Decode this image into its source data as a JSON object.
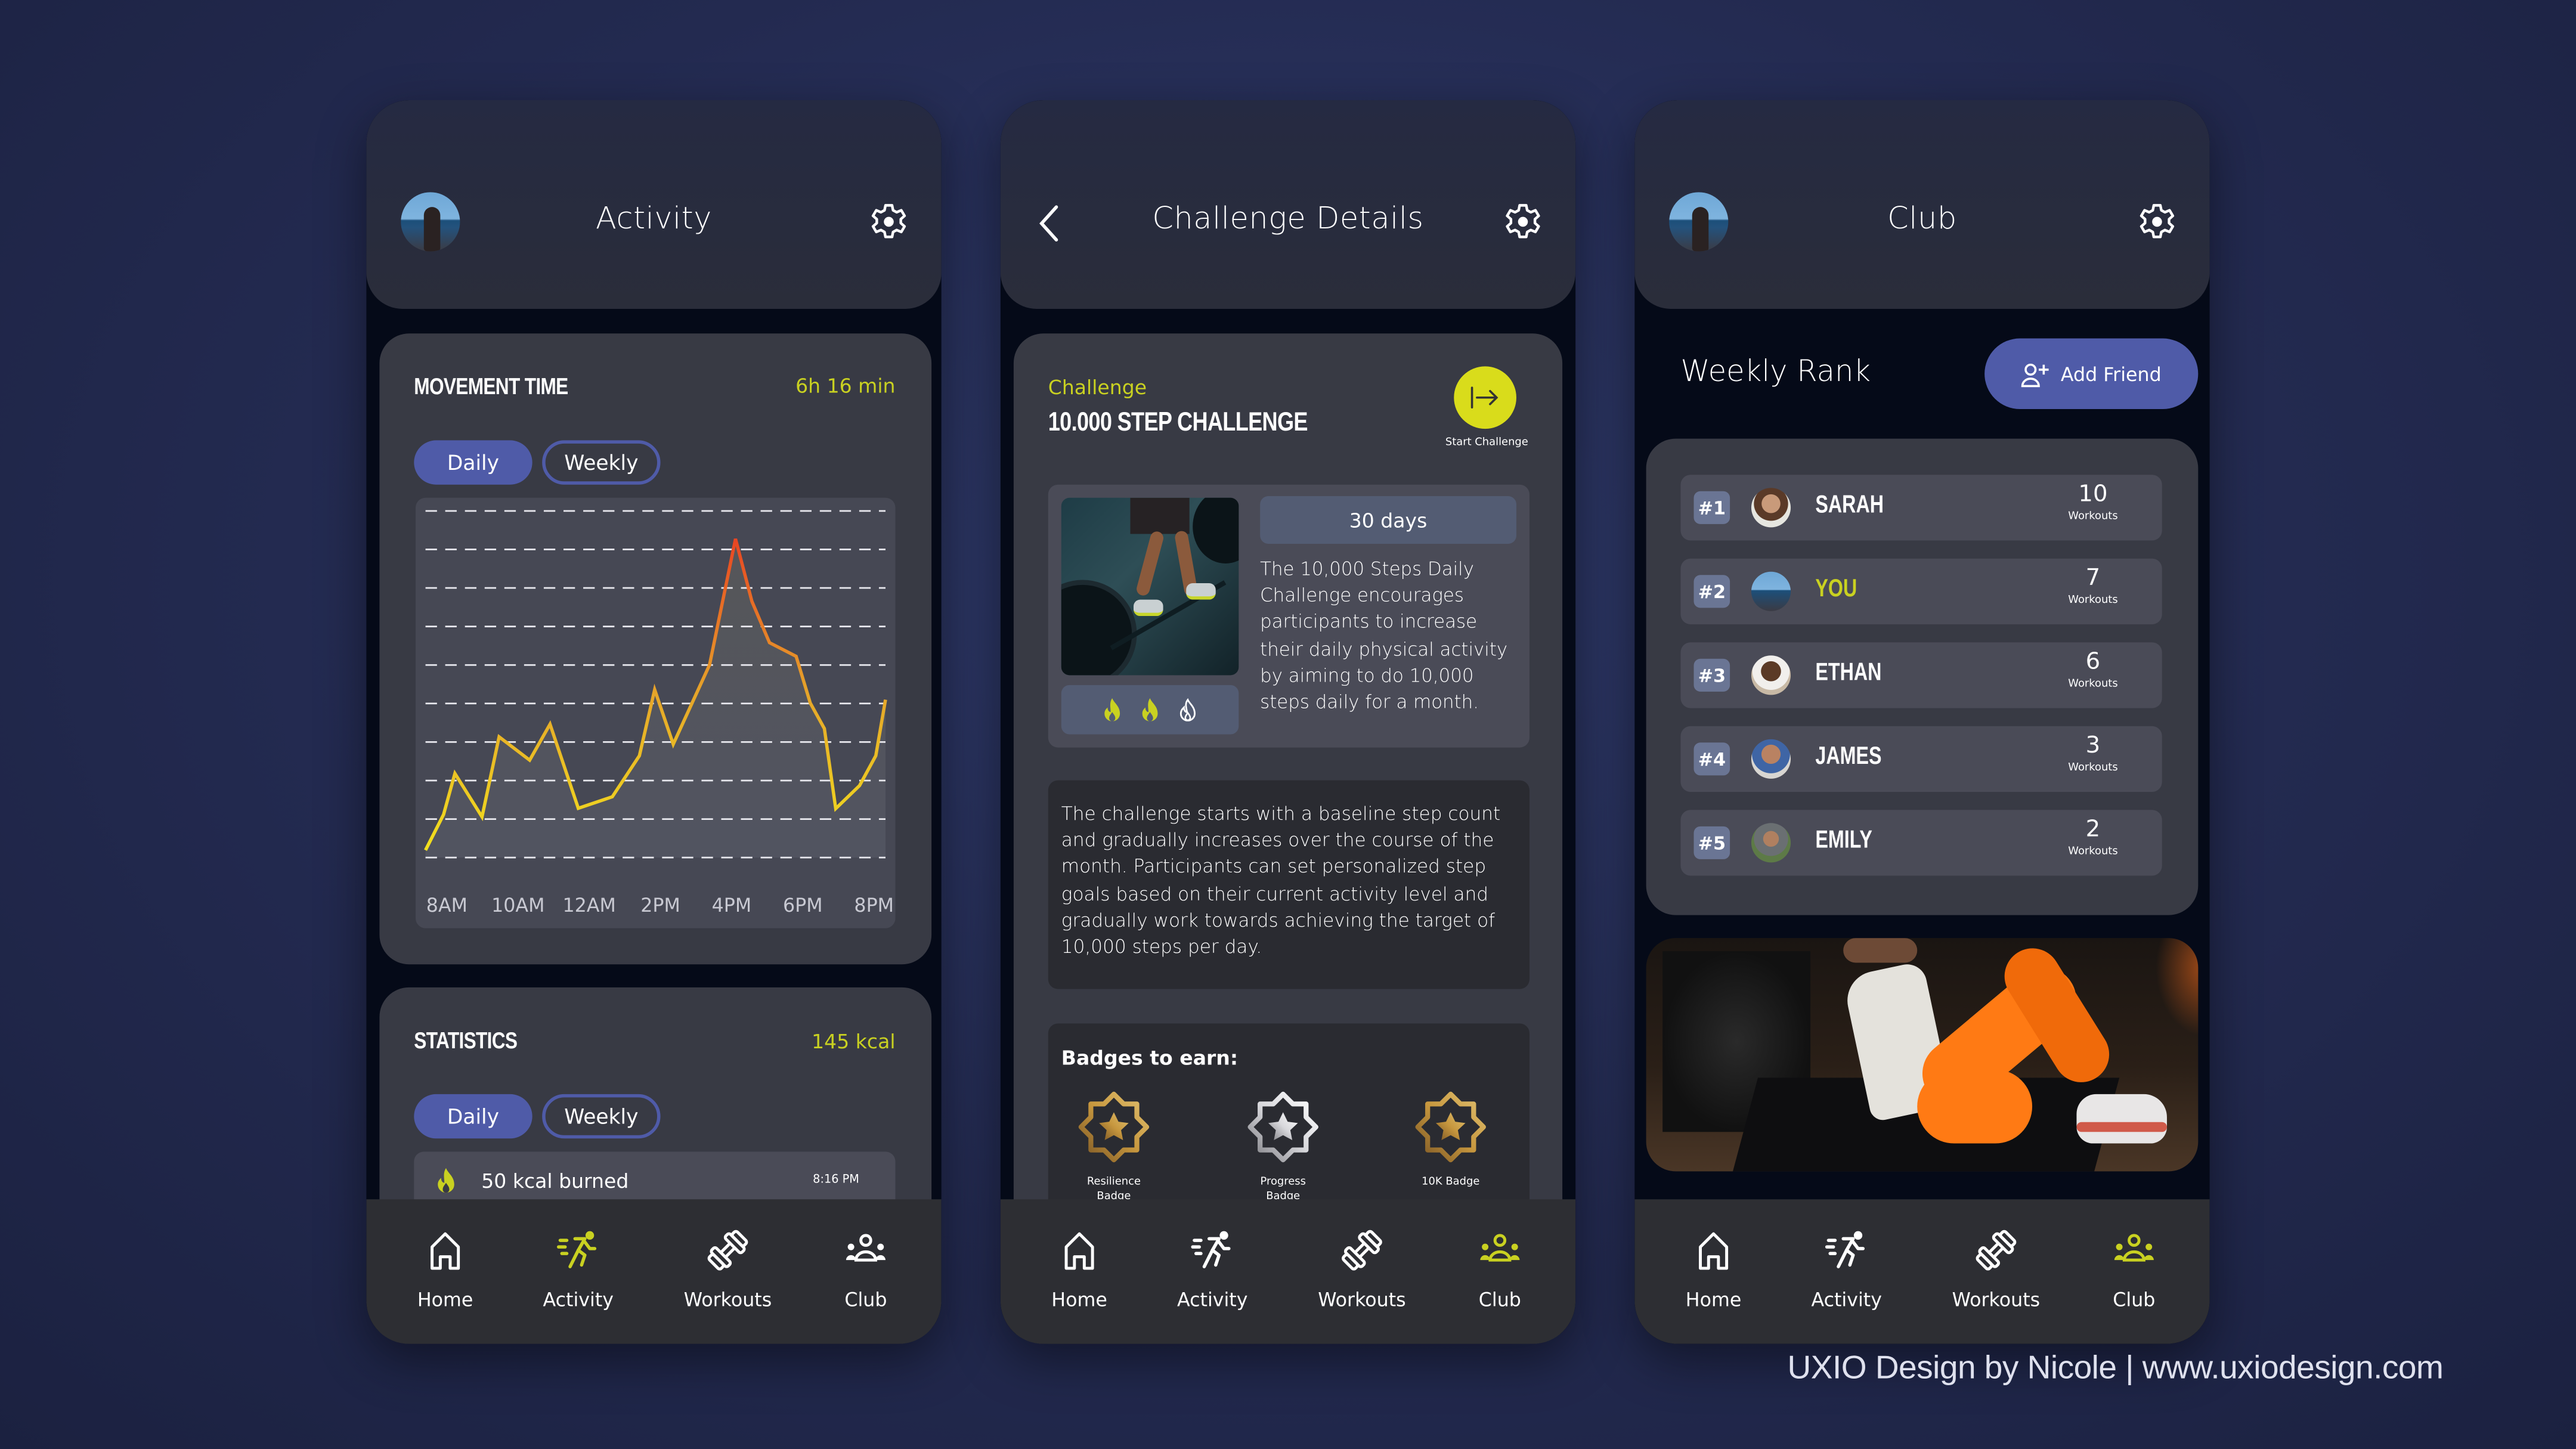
{
  "watermark": "UXIO Design by Nicole | www.uxiodesign.com",
  "colors": {
    "accent_yellow": "#c9d121",
    "accent_blue": "#4f5ba8",
    "card": "#383a44",
    "nav": "#2d2e33"
  },
  "nav": {
    "items": [
      {
        "label": "Home",
        "icon": "home-icon"
      },
      {
        "label": "Activity",
        "icon": "running-icon"
      },
      {
        "label": "Workouts",
        "icon": "dumbbell-icon"
      },
      {
        "label": "Club",
        "icon": "group-icon"
      }
    ]
  },
  "activity": {
    "header": {
      "title": "Activity",
      "avatar": "user-avatar",
      "settings_icon": "gear-icon"
    },
    "movement": {
      "title": "MOVEMENT TIME",
      "value": "6h 16 min",
      "toggle": {
        "daily": "Daily",
        "weekly": "Weekly",
        "selected": "Daily"
      }
    },
    "statistics": {
      "title": "STATISTICS",
      "value": "145 kcal",
      "toggle": {
        "daily": "Daily",
        "weekly": "Weekly",
        "selected": "Daily"
      },
      "entries": [
        {
          "icon": "flame-icon",
          "text": "50 kcal burned",
          "time": "8:16 PM"
        }
      ]
    },
    "active_nav": "Activity"
  },
  "challenge": {
    "header": {
      "title": "Challenge Details",
      "back_icon": "chevron-left-icon",
      "settings_icon": "gear-icon"
    },
    "label": "Challenge",
    "name": "10.000 STEP CHALLENGE",
    "start_label": "Start Challenge",
    "duration": "30 days",
    "summary": "The 10,000 Steps Daily Challenge encourages participants to increase their daily physical activity by aiming to do 10,000 steps daily for a month.",
    "intensity": {
      "filled": 2,
      "total": 3
    },
    "description": "The challenge starts with a baseline step count and gradually increases over the course of the month. Participants can set personalized step goals based on their current activity level and gradually work towards achieving the target of 10,000 steps per day.",
    "badges_title": "Badges to earn:",
    "badges": [
      {
        "name": "Resilience Badge",
        "tier": "gold"
      },
      {
        "name": "Progress Badge",
        "tier": "silver"
      },
      {
        "name": "10K Badge",
        "tier": "gold"
      }
    ],
    "active_nav": "Club"
  },
  "club": {
    "header": {
      "title": "Club",
      "avatar": "user-avatar",
      "settings_icon": "gear-icon"
    },
    "weekly_rank_title": "Weekly Rank",
    "add_friend_label": "Add Friend",
    "ranks": [
      {
        "rank": "#1",
        "name": "SARAH",
        "count": "10",
        "unit": "Workouts",
        "is_you": false
      },
      {
        "rank": "#2",
        "name": "YOU",
        "count": "7",
        "unit": "Workouts",
        "is_you": true
      },
      {
        "rank": "#3",
        "name": "ETHAN",
        "count": "6",
        "unit": "Workouts",
        "is_you": false
      },
      {
        "rank": "#4",
        "name": "JAMES",
        "count": "3",
        "unit": "Workouts",
        "is_you": false
      },
      {
        "rank": "#5",
        "name": "EMILY",
        "count": "2",
        "unit": "Workouts",
        "is_you": false
      }
    ],
    "active_nav": "Club"
  },
  "chart_data": {
    "type": "area",
    "title": "MOVEMENT TIME",
    "xlabel": "",
    "ylabel": "",
    "x_tick_labels": [
      "8AM",
      "10AM",
      "12AM",
      "2PM",
      "4PM",
      "6PM",
      "8PM"
    ],
    "x": [
      0,
      0.32,
      0.52,
      1,
      1.3,
      1.84,
      2.2,
      2.7,
      3.3,
      3.78,
      4.05,
      4.38,
      5.02,
      5.48,
      5.77,
      6.08,
      6.55,
      6.8,
      7.05,
      7.25,
      7.67,
      7.96,
      8.13
    ],
    "values": [
      0.2,
      1.16,
      2.27,
      1.1,
      3.26,
      2.63,
      3.6,
      1.33,
      1.64,
      2.75,
      4.53,
      3.06,
      5.2,
      8.6,
      6.91,
      5.8,
      5.43,
      4.17,
      3.48,
      1.32,
      1.94,
      2.75,
      4.26
    ],
    "ylim": [
      0,
      9
    ],
    "grid": true,
    "gridline_count": 10,
    "line_gradient": [
      "#f2e01e",
      "#e5a52a",
      "#e84523"
    ]
  }
}
